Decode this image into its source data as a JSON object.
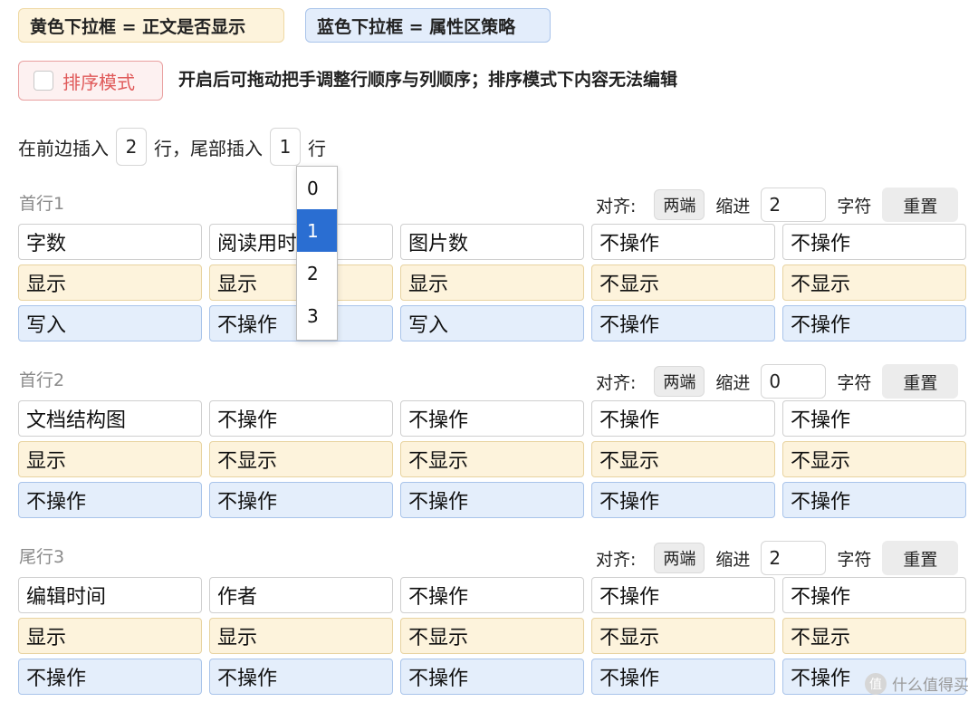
{
  "legend": {
    "yellow": "黄色下拉框 = 正文是否显示",
    "blue": "蓝色下拉框 = 属性区策略"
  },
  "sort_mode": {
    "label": "排序模式",
    "checked": false,
    "hint": "开启后可拖动把手调整行顺序与列顺序；排序模式下内容无法编辑"
  },
  "insert": {
    "front_label": "在前边插入",
    "front_value": "2",
    "mid_label": "行，尾部插入",
    "tail_value": "1",
    "end_label": "行",
    "dropdown_options": [
      "0",
      "1",
      "2",
      "3"
    ],
    "dropdown_selected": "1"
  },
  "controls_labels": {
    "align": "对齐:",
    "align_value": "两端",
    "indent": "缩进",
    "unit": "字符",
    "reset": "重置"
  },
  "sections": [
    {
      "title": "首行1",
      "indent_value": "2",
      "rows": [
        [
          "字数",
          "阅读用时",
          "图片数",
          "不操作",
          "不操作"
        ],
        [
          "显示",
          "显示",
          "显示",
          "不显示",
          "不显示"
        ],
        [
          "写入",
          "不操作",
          "写入",
          "不操作",
          "不操作"
        ]
      ]
    },
    {
      "title": "首行2",
      "indent_value": "0",
      "rows": [
        [
          "文档结构图",
          "不操作",
          "不操作",
          "不操作",
          "不操作"
        ],
        [
          "显示",
          "不显示",
          "不显示",
          "不显示",
          "不显示"
        ],
        [
          "不操作",
          "不操作",
          "不操作",
          "不操作",
          "不操作"
        ]
      ]
    },
    {
      "title": "尾行3",
      "indent_value": "2",
      "rows": [
        [
          "编辑时间",
          "作者",
          "不操作",
          "不操作",
          "不操作"
        ],
        [
          "显示",
          "显示",
          "不显示",
          "不显示",
          "不显示"
        ],
        [
          "不操作",
          "不操作",
          "不操作",
          "不操作",
          "不操作"
        ]
      ]
    }
  ],
  "watermark": {
    "logo_char": "值",
    "text": "什么值得买"
  }
}
